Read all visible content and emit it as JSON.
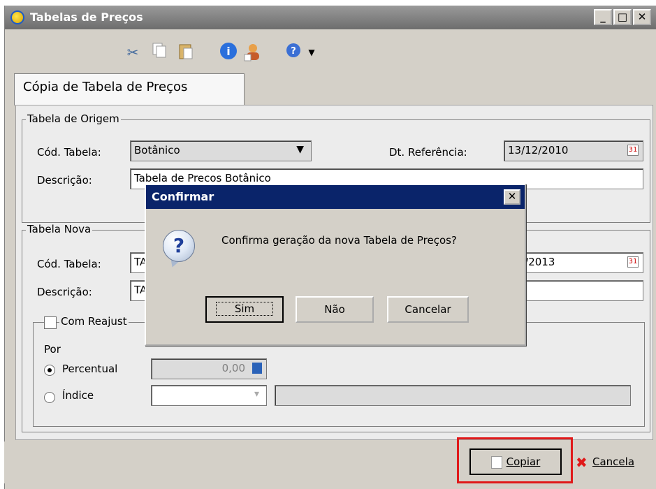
{
  "window": {
    "title": "Tabelas de Preços",
    "min": "_",
    "max": "□",
    "close": "✕"
  },
  "toolbar": {
    "icons": [
      "scissors-icon",
      "copy-icon",
      "paste-icon",
      "info-icon",
      "user-icon",
      "help-icon",
      "dropdown-arrow-icon"
    ]
  },
  "tab": {
    "label": "Cópia de Tabela de Preços"
  },
  "origem": {
    "group_title": "Tabela de Origem",
    "cod_label": "Cód. Tabela:",
    "cod_value": "Botânico",
    "dt_label": "Dt. Referência:",
    "dt_value": "13/12/2010",
    "desc_label": "Descrição:",
    "desc_value": "Tabela de Precos Botânico"
  },
  "nova": {
    "group_title": "Tabela Nova",
    "cod_label": "Cód. Tabela:",
    "cod_value": "TA",
    "dt_value": "/11/2013",
    "desc_label": "Descrição:",
    "desc_value": "TA"
  },
  "reajuste": {
    "checkbox_label": "Com Reajust",
    "por_label": "Por",
    "percentual_label": "Percentual",
    "percentual_value": "0,00",
    "indice_label": "Índice"
  },
  "footer": {
    "copiar": "Copiar",
    "cancela": "Cancela"
  },
  "dialog": {
    "title": "Confirmar",
    "message": "Confirma geração da nova Tabela de Preços?",
    "sim": "Sim",
    "nao": "Não",
    "cancelar": "Cancelar",
    "close": "✕"
  },
  "colors": {
    "title_bar": "#6d6d6d",
    "dialog_title": "#0a246a",
    "highlight": "#e0191a"
  }
}
